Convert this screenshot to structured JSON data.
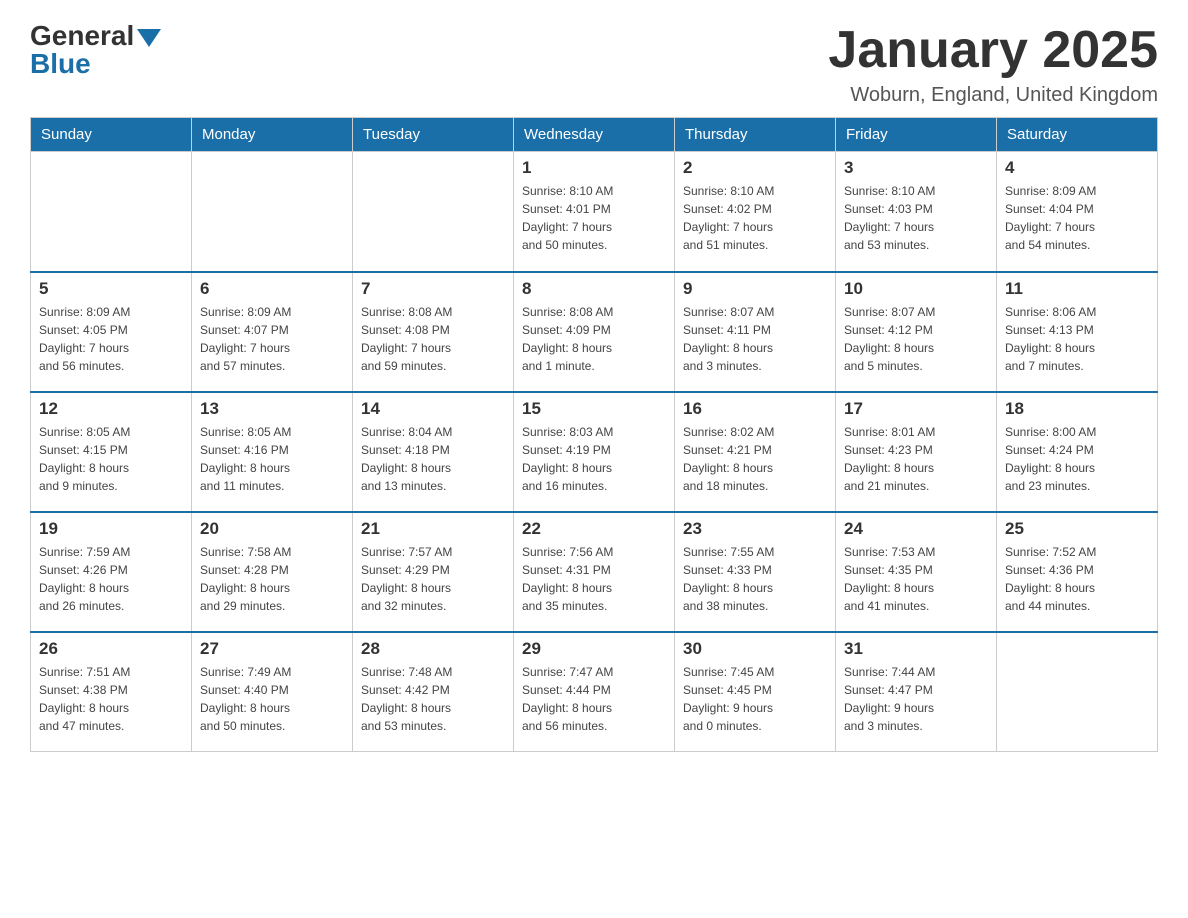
{
  "header": {
    "logo_general": "General",
    "logo_blue": "Blue",
    "month_title": "January 2025",
    "location": "Woburn, England, United Kingdom"
  },
  "days_of_week": [
    "Sunday",
    "Monday",
    "Tuesday",
    "Wednesday",
    "Thursday",
    "Friday",
    "Saturday"
  ],
  "weeks": [
    [
      {
        "day": "",
        "info": ""
      },
      {
        "day": "",
        "info": ""
      },
      {
        "day": "",
        "info": ""
      },
      {
        "day": "1",
        "info": "Sunrise: 8:10 AM\nSunset: 4:01 PM\nDaylight: 7 hours\nand 50 minutes."
      },
      {
        "day": "2",
        "info": "Sunrise: 8:10 AM\nSunset: 4:02 PM\nDaylight: 7 hours\nand 51 minutes."
      },
      {
        "day": "3",
        "info": "Sunrise: 8:10 AM\nSunset: 4:03 PM\nDaylight: 7 hours\nand 53 minutes."
      },
      {
        "day": "4",
        "info": "Sunrise: 8:09 AM\nSunset: 4:04 PM\nDaylight: 7 hours\nand 54 minutes."
      }
    ],
    [
      {
        "day": "5",
        "info": "Sunrise: 8:09 AM\nSunset: 4:05 PM\nDaylight: 7 hours\nand 56 minutes."
      },
      {
        "day": "6",
        "info": "Sunrise: 8:09 AM\nSunset: 4:07 PM\nDaylight: 7 hours\nand 57 minutes."
      },
      {
        "day": "7",
        "info": "Sunrise: 8:08 AM\nSunset: 4:08 PM\nDaylight: 7 hours\nand 59 minutes."
      },
      {
        "day": "8",
        "info": "Sunrise: 8:08 AM\nSunset: 4:09 PM\nDaylight: 8 hours\nand 1 minute."
      },
      {
        "day": "9",
        "info": "Sunrise: 8:07 AM\nSunset: 4:11 PM\nDaylight: 8 hours\nand 3 minutes."
      },
      {
        "day": "10",
        "info": "Sunrise: 8:07 AM\nSunset: 4:12 PM\nDaylight: 8 hours\nand 5 minutes."
      },
      {
        "day": "11",
        "info": "Sunrise: 8:06 AM\nSunset: 4:13 PM\nDaylight: 8 hours\nand 7 minutes."
      }
    ],
    [
      {
        "day": "12",
        "info": "Sunrise: 8:05 AM\nSunset: 4:15 PM\nDaylight: 8 hours\nand 9 minutes."
      },
      {
        "day": "13",
        "info": "Sunrise: 8:05 AM\nSunset: 4:16 PM\nDaylight: 8 hours\nand 11 minutes."
      },
      {
        "day": "14",
        "info": "Sunrise: 8:04 AM\nSunset: 4:18 PM\nDaylight: 8 hours\nand 13 minutes."
      },
      {
        "day": "15",
        "info": "Sunrise: 8:03 AM\nSunset: 4:19 PM\nDaylight: 8 hours\nand 16 minutes."
      },
      {
        "day": "16",
        "info": "Sunrise: 8:02 AM\nSunset: 4:21 PM\nDaylight: 8 hours\nand 18 minutes."
      },
      {
        "day": "17",
        "info": "Sunrise: 8:01 AM\nSunset: 4:23 PM\nDaylight: 8 hours\nand 21 minutes."
      },
      {
        "day": "18",
        "info": "Sunrise: 8:00 AM\nSunset: 4:24 PM\nDaylight: 8 hours\nand 23 minutes."
      }
    ],
    [
      {
        "day": "19",
        "info": "Sunrise: 7:59 AM\nSunset: 4:26 PM\nDaylight: 8 hours\nand 26 minutes."
      },
      {
        "day": "20",
        "info": "Sunrise: 7:58 AM\nSunset: 4:28 PM\nDaylight: 8 hours\nand 29 minutes."
      },
      {
        "day": "21",
        "info": "Sunrise: 7:57 AM\nSunset: 4:29 PM\nDaylight: 8 hours\nand 32 minutes."
      },
      {
        "day": "22",
        "info": "Sunrise: 7:56 AM\nSunset: 4:31 PM\nDaylight: 8 hours\nand 35 minutes."
      },
      {
        "day": "23",
        "info": "Sunrise: 7:55 AM\nSunset: 4:33 PM\nDaylight: 8 hours\nand 38 minutes."
      },
      {
        "day": "24",
        "info": "Sunrise: 7:53 AM\nSunset: 4:35 PM\nDaylight: 8 hours\nand 41 minutes."
      },
      {
        "day": "25",
        "info": "Sunrise: 7:52 AM\nSunset: 4:36 PM\nDaylight: 8 hours\nand 44 minutes."
      }
    ],
    [
      {
        "day": "26",
        "info": "Sunrise: 7:51 AM\nSunset: 4:38 PM\nDaylight: 8 hours\nand 47 minutes."
      },
      {
        "day": "27",
        "info": "Sunrise: 7:49 AM\nSunset: 4:40 PM\nDaylight: 8 hours\nand 50 minutes."
      },
      {
        "day": "28",
        "info": "Sunrise: 7:48 AM\nSunset: 4:42 PM\nDaylight: 8 hours\nand 53 minutes."
      },
      {
        "day": "29",
        "info": "Sunrise: 7:47 AM\nSunset: 4:44 PM\nDaylight: 8 hours\nand 56 minutes."
      },
      {
        "day": "30",
        "info": "Sunrise: 7:45 AM\nSunset: 4:45 PM\nDaylight: 9 hours\nand 0 minutes."
      },
      {
        "day": "31",
        "info": "Sunrise: 7:44 AM\nSunset: 4:47 PM\nDaylight: 9 hours\nand 3 minutes."
      },
      {
        "day": "",
        "info": ""
      }
    ]
  ]
}
